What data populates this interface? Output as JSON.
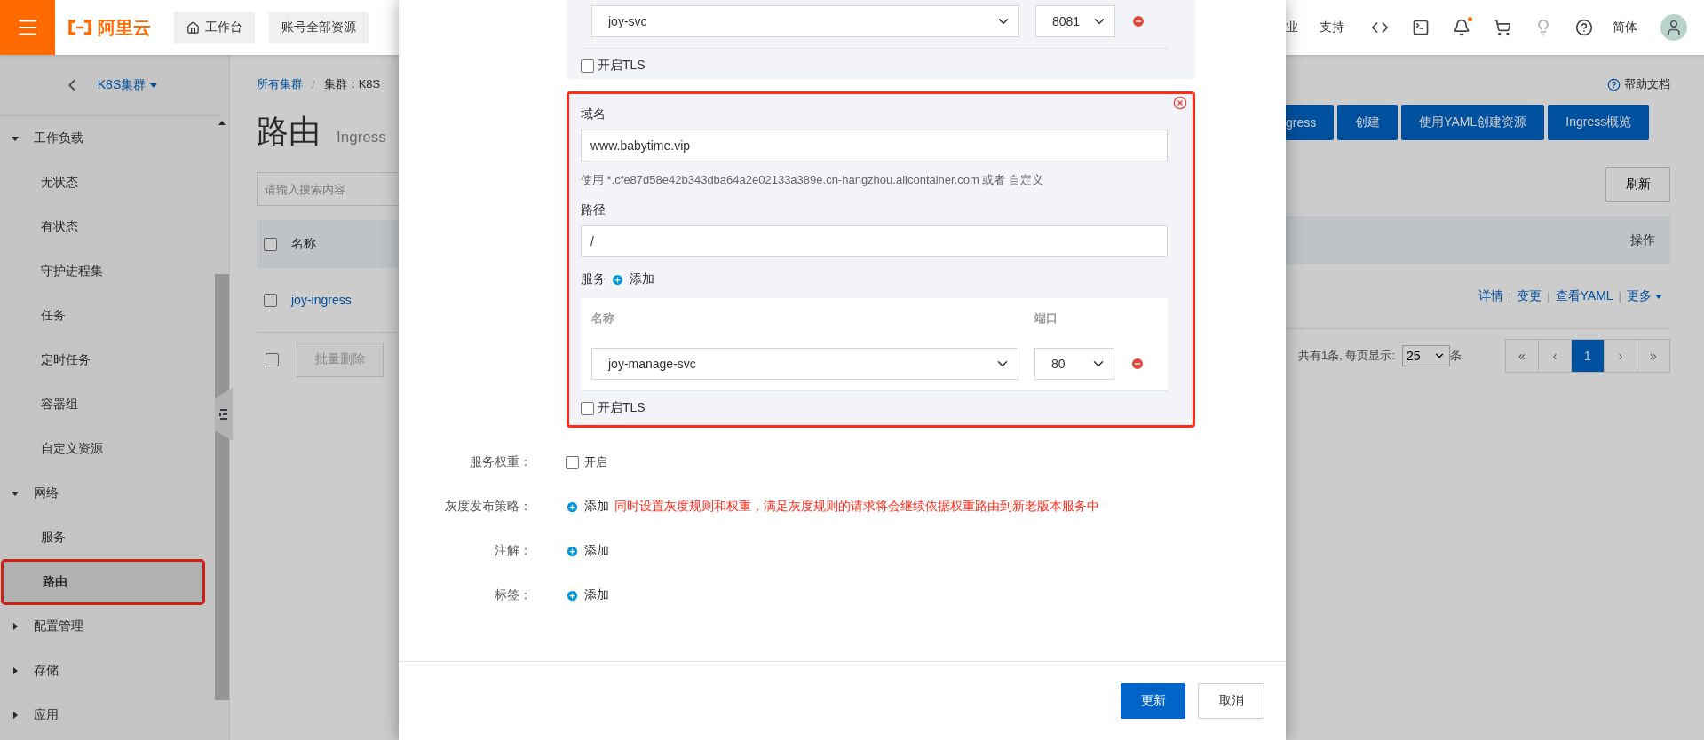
{
  "topbar": {
    "logo": "阿里云",
    "workbench": "工作台",
    "resources": "账号全部资源",
    "links": [
      "业",
      "支持"
    ],
    "language": "简体",
    "notification_dot": true
  },
  "sidebar": {
    "title": "K8S集群",
    "groups": [
      {
        "label": "工作负载",
        "expanded": true,
        "children": [
          {
            "label": "无状态",
            "selected": false
          },
          {
            "label": "有状态",
            "selected": false
          },
          {
            "label": "守护进程集",
            "selected": false
          },
          {
            "label": "任务",
            "selected": false
          },
          {
            "label": "定时任务",
            "selected": false
          },
          {
            "label": "容器组",
            "selected": false
          },
          {
            "label": "自定义资源",
            "selected": false
          }
        ]
      },
      {
        "label": "网络",
        "expanded": true,
        "children": [
          {
            "label": "服务",
            "selected": false
          },
          {
            "label": "路由",
            "selected": true,
            "highlighted": true
          }
        ]
      },
      {
        "label": "配置管理",
        "expanded": false
      },
      {
        "label": "存储",
        "expanded": false
      },
      {
        "label": "应用",
        "expanded": false
      }
    ]
  },
  "page": {
    "breadcrumb": [
      "所有集群",
      "/",
      "集群：K8S"
    ],
    "title": "路由",
    "subtitle": "Ingress",
    "help": "帮助文档",
    "actions": [
      "gress",
      "创建",
      "使用YAML创建资源",
      "Ingress概览"
    ],
    "search": {
      "placeholder": "请输入搜索内容"
    },
    "refresh": "刷新",
    "table": {
      "columns": [
        "名称",
        "操作"
      ],
      "all_checked": false,
      "rows": [
        {
          "name": "joy-ingress",
          "checked": false,
          "actions": [
            {
              "label": "详情"
            },
            {
              "separator": "|",
              "label": "变更"
            },
            {
              "separator": "|",
              "label": "查看YAML"
            },
            {
              "separator": "|",
              "label": "更多"
            }
          ]
        }
      ]
    },
    "batch_checked": false,
    "batch_delete": "批量删除",
    "pagination": {
      "summary": "共有1条, 每页显示:",
      "page_size": "25",
      "unit": "条",
      "pages": [
        {
          "label": "«",
          "selected": false
        },
        {
          "label": "‹",
          "selected": false
        },
        {
          "label": "1",
          "selected": true
        },
        {
          "label": "›",
          "selected": false
        },
        {
          "label": "»",
          "selected": false
        }
      ]
    }
  },
  "dialog": {
    "rules": [
      {
        "highlighted": false,
        "services": [
          {
            "name": "joy-svc",
            "port": "8081"
          }
        ],
        "tls_label": "开启TLS",
        "tls": false
      },
      {
        "highlighted": true,
        "domain_label": "域名",
        "domain": "www.babytime.vip",
        "hint": "使用 *.cfe87d58e42b343dba64a2e02133a389e.cn-hangzhou.alicontainer.com 或者 自定义",
        "path_label": "路径",
        "path": "/",
        "service_label": "服务",
        "add": "添加",
        "columns": [
          "名称",
          "端口"
        ],
        "services": [
          {
            "name": "joy-manage-svc",
            "port": "80"
          }
        ],
        "tls_label": "开启TLS",
        "tls": false
      }
    ],
    "fields": [
      {
        "label": "服务权重：",
        "kind": "checkbox",
        "text": "开启",
        "checked": false
      },
      {
        "label": "灰度发布策略：",
        "kind": "add",
        "text": "添加",
        "note": "同时设置灰度规则和权重，满足灰度规则的请求将会继续依据权重路由到新老版本服务中"
      },
      {
        "label": "注解：",
        "kind": "add",
        "text": "添加"
      },
      {
        "label": "标签：",
        "kind": "add",
        "text": "添加"
      }
    ],
    "buttons": [
      {
        "label": "更新",
        "primary": true
      },
      {
        "label": "取消",
        "primary": false
      }
    ]
  }
}
